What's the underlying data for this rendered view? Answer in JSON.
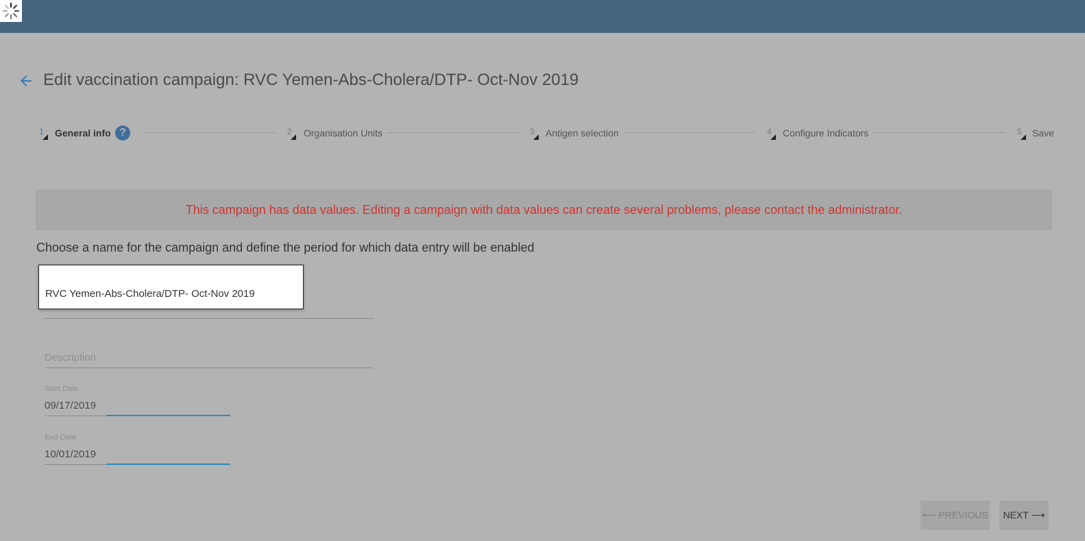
{
  "header": {
    "loading_icon": "spinner-icon",
    "color": "#45667f"
  },
  "page": {
    "title": "Edit vaccination campaign: RVC Yemen-Abs-Cholera/DTP- Oct-Nov 2019",
    "back_icon": "arrow-left-icon"
  },
  "stepper": {
    "steps": [
      {
        "number": "1",
        "label": "General info",
        "active": true
      },
      {
        "number": "2",
        "label": "Organisation Units",
        "active": false
      },
      {
        "number": "3",
        "label": "Antigen selection",
        "active": false
      },
      {
        "number": "4",
        "label": "Configure Indicators",
        "active": false
      },
      {
        "number": "5",
        "label": "Save",
        "active": false
      }
    ],
    "help_icon_glyph": "?"
  },
  "warning": {
    "text": "This campaign has data values. Editing a campaign with data values can create several problems, please contact the administrator.",
    "color": "#cf3530"
  },
  "form": {
    "instructions": "Choose a name for the campaign and define the period for which data entry will be enabled",
    "name_value": "RVC Yemen-Abs-Cholera/DTP- Oct-Nov 2019",
    "description_placeholder": "Description",
    "start_date_label": "Start Date",
    "start_date_value": "09/17/2019",
    "end_date_label": "End Date",
    "end_date_value": "10/01/2019"
  },
  "buttons": {
    "previous": "⟵ PREVIOUS",
    "next": "NEXT ⟶"
  }
}
